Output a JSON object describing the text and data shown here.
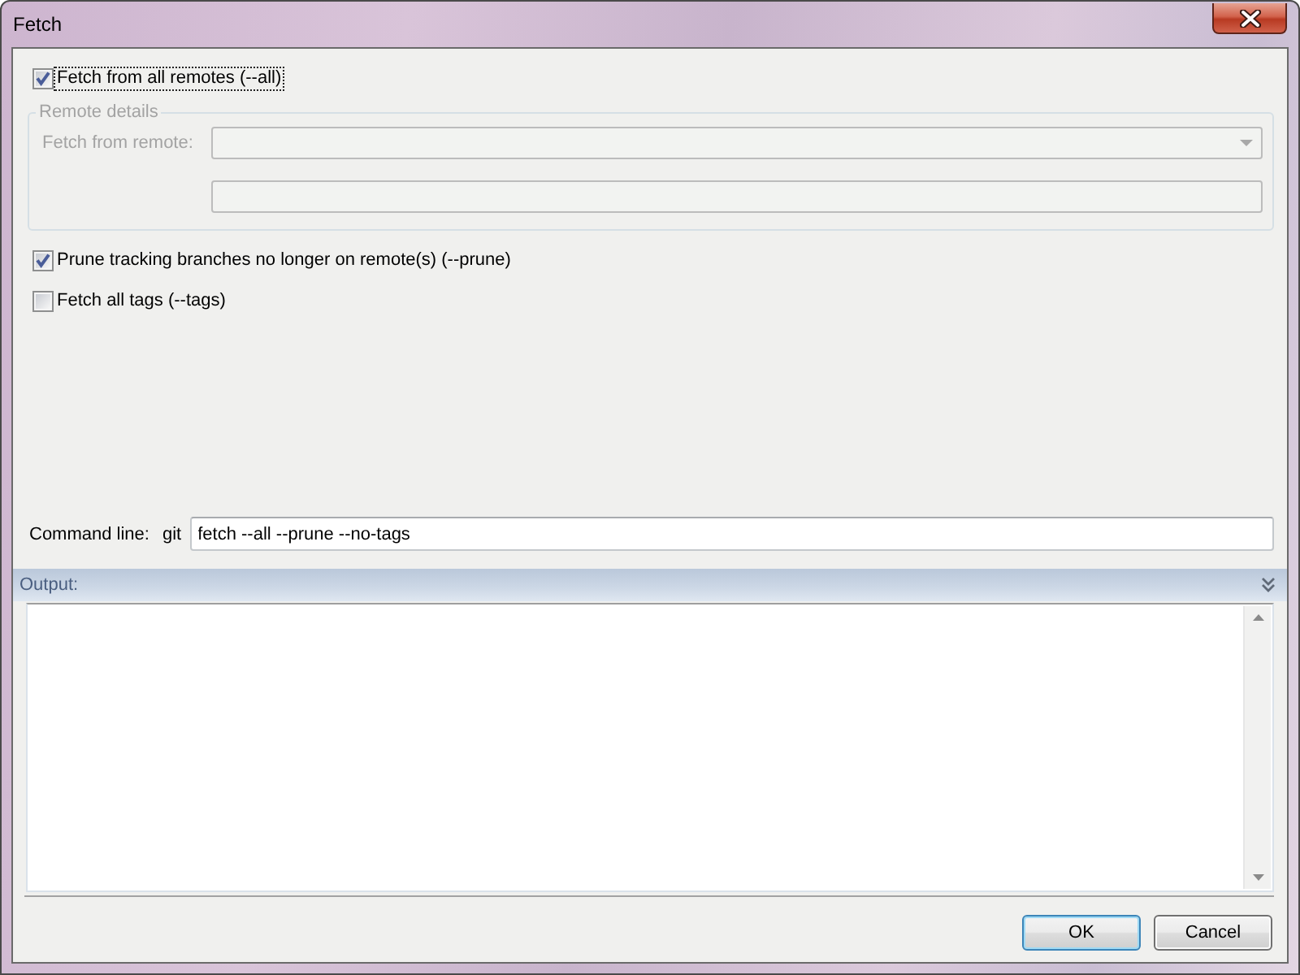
{
  "window": {
    "title": "Fetch"
  },
  "fetch_all": {
    "label": "Fetch from all remotes (--all)",
    "checked": true,
    "focused": true
  },
  "remote_details": {
    "title": "Remote details",
    "disabled": true,
    "remote_label": "Fetch from remote:"
  },
  "options": [
    {
      "label": "Prune tracking branches no longer on remote(s) (--prune)",
      "checked": true,
      "focused": false
    },
    {
      "label": "Fetch all tags (--tags)",
      "checked": false,
      "focused": false
    }
  ],
  "command_line": {
    "label": "Command line:",
    "program": "git",
    "value": "fetch --all --prune --no-tags"
  },
  "output": {
    "title": "Output:"
  },
  "buttons": [
    {
      "label": "OK",
      "default": true
    },
    {
      "label": "Cancel",
      "default": false
    }
  ]
}
